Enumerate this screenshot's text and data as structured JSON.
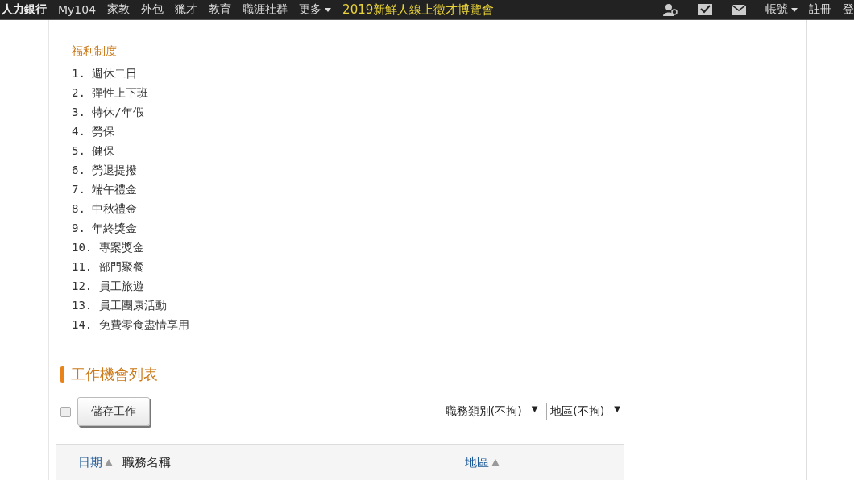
{
  "nav": {
    "brand": "人力銀行",
    "items": [
      {
        "label": "My104",
        "kind": "link"
      },
      {
        "label": "家教",
        "kind": "link"
      },
      {
        "label": "外包",
        "kind": "link"
      },
      {
        "label": "獵才",
        "kind": "link"
      },
      {
        "label": "教育",
        "kind": "link"
      },
      {
        "label": "職涯社群",
        "kind": "link"
      },
      {
        "label": "更多",
        "kind": "menu"
      },
      {
        "label": "2019新鮮人線上徵才博覽會",
        "kind": "promo"
      }
    ],
    "right": [
      {
        "kind": "person"
      },
      {
        "kind": "check"
      },
      {
        "kind": "mail"
      },
      {
        "kind": "menu",
        "label": "帳號"
      },
      {
        "kind": "link",
        "label": "註冊"
      },
      {
        "kind": "link",
        "label": "登"
      }
    ]
  },
  "benefits": {
    "title": "福利制度",
    "items": [
      "1. 週休二日",
      "2. 彈性上下班",
      "3. 特休/年假",
      "4. 勞保",
      "5. 健保",
      "6. 勞退提撥",
      "7. 端午禮金",
      "8. 中秋禮金",
      "9. 年終獎金",
      "10. 專案獎金",
      "11. 部門聚餐",
      "12. 員工旅遊",
      "13. 員工團康活動",
      "14. 免費零食盡情享用"
    ]
  },
  "jobs": {
    "title": "工作機會列表",
    "select_all": {
      "checked": false
    },
    "save_button": "儲存工作",
    "filters": [
      {
        "label": "職務類別(不拘)",
        "arrow": "▼"
      },
      {
        "label": "地區(不拘)",
        "arrow": "▼"
      }
    ],
    "columns": [
      {
        "label": "日期",
        "sortable": true
      },
      {
        "label": "職務名稱",
        "sortable": false
      },
      {
        "label": "地區",
        "sortable": true
      }
    ]
  }
}
